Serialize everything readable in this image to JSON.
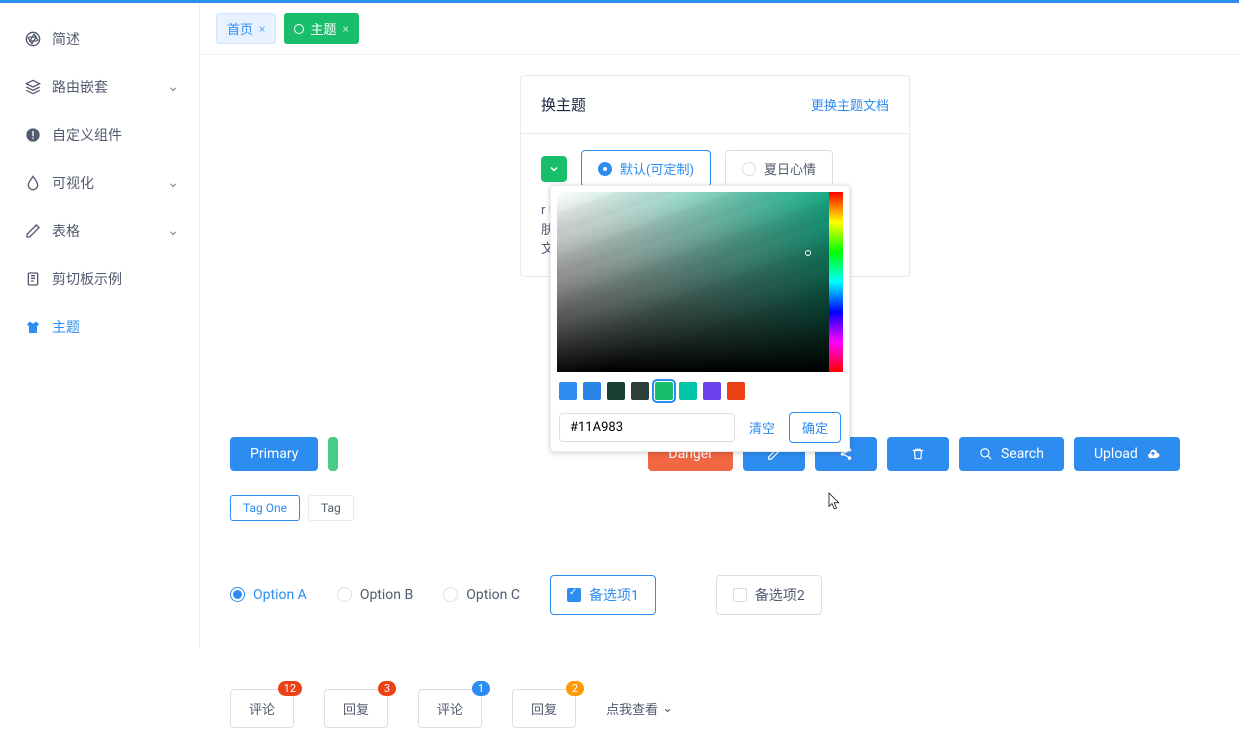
{
  "sidebar": {
    "items": [
      {
        "label": "简述",
        "icon": "aperture-icon",
        "expandable": false
      },
      {
        "label": "路由嵌套",
        "icon": "layers-icon",
        "expandable": true
      },
      {
        "label": "自定义组件",
        "icon": "alert-icon",
        "expandable": false
      },
      {
        "label": "可视化",
        "icon": "drop-icon",
        "expandable": true
      },
      {
        "label": "表格",
        "icon": "pencil-icon",
        "expandable": true
      },
      {
        "label": "剪切板示例",
        "icon": "clipboard-icon",
        "expandable": false
      },
      {
        "label": "主题",
        "icon": "shirt-icon",
        "expandable": false,
        "active": true
      }
    ]
  },
  "tabs": [
    {
      "label": "首页",
      "type": "home",
      "closable": true
    },
    {
      "label": "主题",
      "type": "active",
      "closable": true
    }
  ],
  "card": {
    "title": "换主题",
    "link": "更换主题文档",
    "options": [
      {
        "label": "默认(可定制)",
        "selected": true
      },
      {
        "label": "夏日心情",
        "selected": false
      }
    ],
    "desc_lines": [
      "r 中的更换皮肤有明显的区别，他",
      "肤方法，各自有不同的应用场",
      "文档。"
    ]
  },
  "color_picker": {
    "hex": "#11A983",
    "clear": "清空",
    "confirm": "确定",
    "swatches": [
      "#2d8cf0",
      "#2b85e4",
      "#17233d",
      "#515a6e",
      "#19be6b",
      "#00c4a7",
      "#6b40ed",
      "#ed4014"
    ],
    "selected_index": 4
  },
  "buttons": {
    "primary": "Primary",
    "danger": "Danger",
    "search": "Search",
    "upload": "Upload"
  },
  "tags": [
    "Tag One",
    "Tag"
  ],
  "radios": {
    "a": "Option A",
    "b": "Option B",
    "c": "Option C",
    "selected": "a",
    "chk1": "备选项1",
    "chk2": "备选项2"
  },
  "comments": {
    "items": [
      {
        "label": "评论",
        "badge": "12",
        "color": "red"
      },
      {
        "label": "回复",
        "badge": "3",
        "color": "red"
      },
      {
        "label": "评论",
        "badge": "1",
        "color": "blue"
      },
      {
        "label": "回复",
        "badge": "2",
        "color": "yel"
      }
    ],
    "dropdown": "点我查看"
  }
}
